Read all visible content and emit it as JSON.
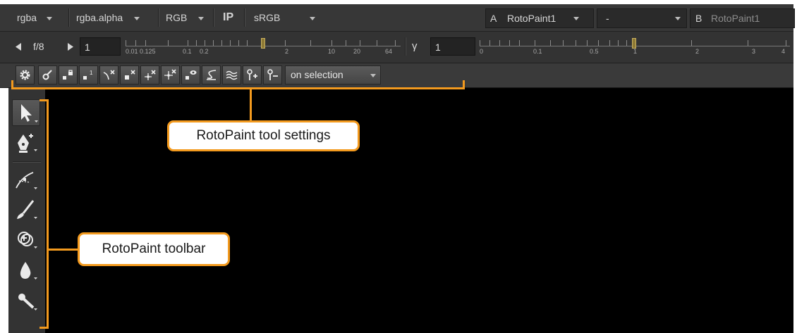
{
  "channel_bar": {
    "layer": "rgba",
    "channel": "rgba.alpha",
    "display": "RGB",
    "ip_label": "IP",
    "lut": "sRGB",
    "a_label": "A",
    "a_input": "RotoPaint1",
    "operation": "-",
    "b_label": "B",
    "b_input": "RotoPaint1"
  },
  "gain_bar": {
    "fstop": "f/8",
    "gain_value": "1",
    "gain_ticks": [
      "0.01",
      "0.125",
      "0.1",
      "0.2",
      "2",
      "10",
      "20",
      "64"
    ],
    "gamma_label": "γ",
    "gamma_value": "1",
    "gamma_ticks": [
      "0",
      "0.1",
      "0.5",
      "1",
      "2",
      "3",
      "4"
    ]
  },
  "tool_settings": {
    "buttons": [
      "settings-icon",
      "feather-icon",
      "lock-point-icon",
      "point-one-icon",
      "remove-tangent-icon",
      "delete-point-icon",
      "add-point-icon",
      "move-point-icon",
      "visibility-icon",
      "curve-icon",
      "motion-blur-icon",
      "add-feather-icon",
      "remove-feather-icon"
    ],
    "selection_mode": "on selection"
  },
  "toolbar": {
    "tools": [
      "select-arrow-icon",
      "bezier-pen-icon",
      "b-spline-icon",
      "brush-icon",
      "clone-icon",
      "blur-drop-icon",
      "dodge-icon"
    ]
  },
  "callouts": {
    "settings_label": "RotoPaint tool settings",
    "toolbar_label": "RotoPaint toolbar"
  },
  "colors": {
    "callout_accent": "#f39a1e",
    "viewer_background": "#000000",
    "panel": "#373737"
  }
}
